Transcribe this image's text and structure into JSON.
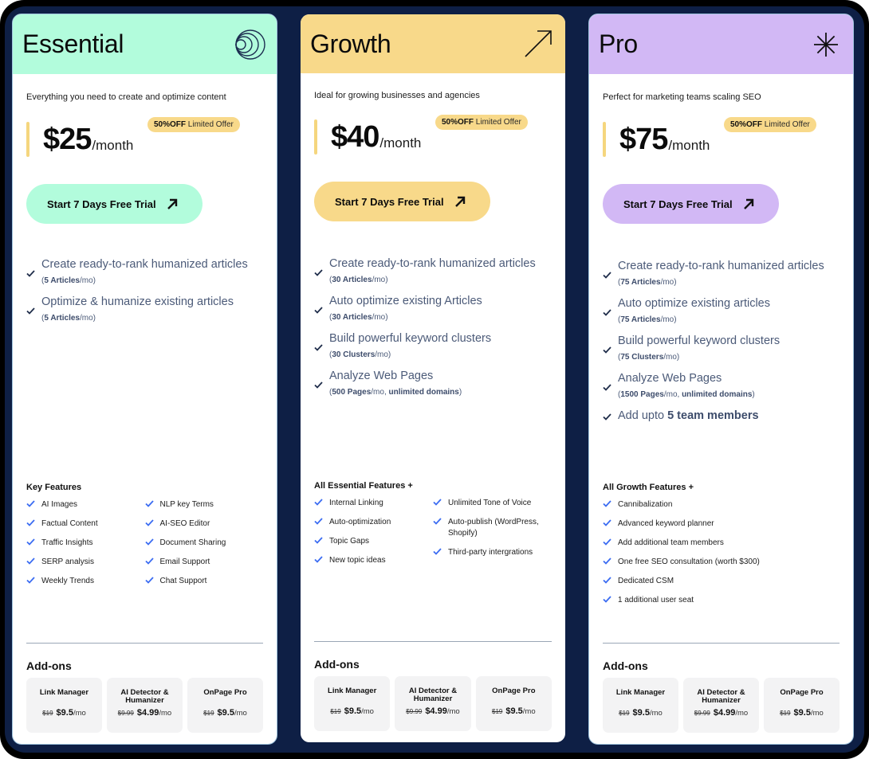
{
  "plans": [
    {
      "id": "essential",
      "name": "Essential",
      "head_color": "#b2fcdc",
      "button_color": "#b2fcdc",
      "icon": "concentric-circles-icon",
      "tagline": "Everything you need to create and optimize content",
      "price": "$25",
      "period": "/month",
      "badge_strong": "50%OFF",
      "badge_text": "Limited Offer",
      "cta": "Start 7 Days Free Trial",
      "main_features": [
        {
          "text": "Create ready-to-rank humanized articles",
          "sub_open": "(",
          "sub_bold": "5 Articles",
          "sub_rest": "/mo)"
        },
        {
          "text": "Optimize & humanize existing articles",
          "sub_open": "(",
          "sub_bold": "5 Articles",
          "sub_rest": "/mo)"
        }
      ],
      "key_title": "Key Features",
      "key_col1": [
        "AI Images",
        "Factual Content",
        "Traffic Insights",
        "SERP analysis",
        "Weekly Trends"
      ],
      "key_col2": [
        "NLP key Terms",
        "AI-SEO Editor",
        "Document Sharing",
        "Email Support",
        "Chat Support"
      ],
      "addons_title": "Add-ons",
      "addons": [
        {
          "name": "Link Manager",
          "old": "$19",
          "price": "$9.5",
          "unit": "/mo"
        },
        {
          "name": "AI Detector & Humanizer",
          "old": "$9.99",
          "price": "$4.99",
          "unit": "/mo"
        },
        {
          "name": "OnPage Pro",
          "old": "$19",
          "price": "$9.5",
          "unit": "/mo"
        }
      ]
    },
    {
      "id": "growth",
      "name": "Growth",
      "head_color": "#f8d98a",
      "button_color": "#f8d98a",
      "icon": "arrow-up-right-icon",
      "tagline": "Ideal for growing businesses and agencies",
      "price": "$40",
      "period": "/month",
      "badge_strong": "50%OFF",
      "badge_text": "Limited Offer",
      "cta": "Start 7 Days Free Trial",
      "main_features": [
        {
          "text": "Create ready-to-rank humanized articles",
          "sub_open": "(",
          "sub_bold": "30 Articles",
          "sub_rest": "/mo)"
        },
        {
          "text": "Auto optimize existing Articles",
          "sub_open": "(",
          "sub_bold": "30 Articles",
          "sub_rest": "/mo)"
        },
        {
          "text": "Build powerful keyword clusters",
          "sub_open": "(",
          "sub_bold": "30 Clusters",
          "sub_rest": "/mo)"
        },
        {
          "text": "Analyze Web Pages",
          "sub_open": "(",
          "sub_bold": "500 Pages",
          "sub_rest": "/mo, ",
          "sub_bold2": "unlimited domains",
          "sub_close": ")"
        }
      ],
      "key_title": "All Essential Features +",
      "key_col1": [
        "Internal Linking",
        "Auto-optimization",
        "Topic Gaps",
        "New topic ideas"
      ],
      "key_col2": [
        "Unlimited Tone of Voice",
        "Auto-publish (WordPress, Shopify)",
        "Third-party intergrations"
      ],
      "addons_title": "Add-ons",
      "addons": [
        {
          "name": "Link Manager",
          "old": "$19",
          "price": "$9.5",
          "unit": "/mo"
        },
        {
          "name": "AI Detector & Humanizer",
          "old": "$9.99",
          "price": "$4.99",
          "unit": "/mo"
        },
        {
          "name": "OnPage Pro",
          "old": "$19",
          "price": "$9.5",
          "unit": "/mo"
        }
      ]
    },
    {
      "id": "pro",
      "name": "Pro",
      "head_color": "#d2b8f5",
      "button_color": "#d2b8f5",
      "icon": "asterisk-icon",
      "tagline": "Perfect for marketing teams scaling SEO",
      "price": "$75",
      "period": "/month",
      "badge_strong": "50%OFF",
      "badge_text": "Limited Offer",
      "cta": "Start 7 Days Free Trial",
      "main_features": [
        {
          "text": "Create ready-to-rank humanized articles",
          "sub_open": "(",
          "sub_bold": "75 Articles",
          "sub_rest": "/mo)"
        },
        {
          "text": "Auto optimize existing articles",
          "sub_open": "(",
          "sub_bold": "75 Articles",
          "sub_rest": "/mo)"
        },
        {
          "text": "Build powerful keyword clusters",
          "sub_open": "(",
          "sub_bold": "75 Clusters",
          "sub_rest": "/mo)"
        },
        {
          "text": "Analyze Web Pages",
          "sub_open": "(",
          "sub_bold": "1500 Pages",
          "sub_rest": "/mo, ",
          "sub_bold2": "unlimited domains",
          "sub_close": ")"
        }
      ],
      "extra_feature": {
        "text": "Add upto ",
        "bold": "5 team members"
      },
      "key_title": "All Growth Features +",
      "key_col1": [
        "Cannibalization",
        "Advanced keyword planner",
        "Add additional team members",
        "One free SEO consultation (worth $300)",
        "Dedicated CSM",
        "1 additional user seat"
      ],
      "key_col2": [],
      "addons_title": "Add-ons",
      "addons": [
        {
          "name": "Link Manager",
          "old": "$19",
          "price": "$9.5",
          "unit": "/mo"
        },
        {
          "name": "AI Detector & Humanizer",
          "old": "$9.99",
          "price": "$4.99",
          "unit": "/mo"
        },
        {
          "name": "OnPage Pro",
          "old": "$19",
          "price": "$9.5",
          "unit": "/mo"
        }
      ]
    }
  ]
}
